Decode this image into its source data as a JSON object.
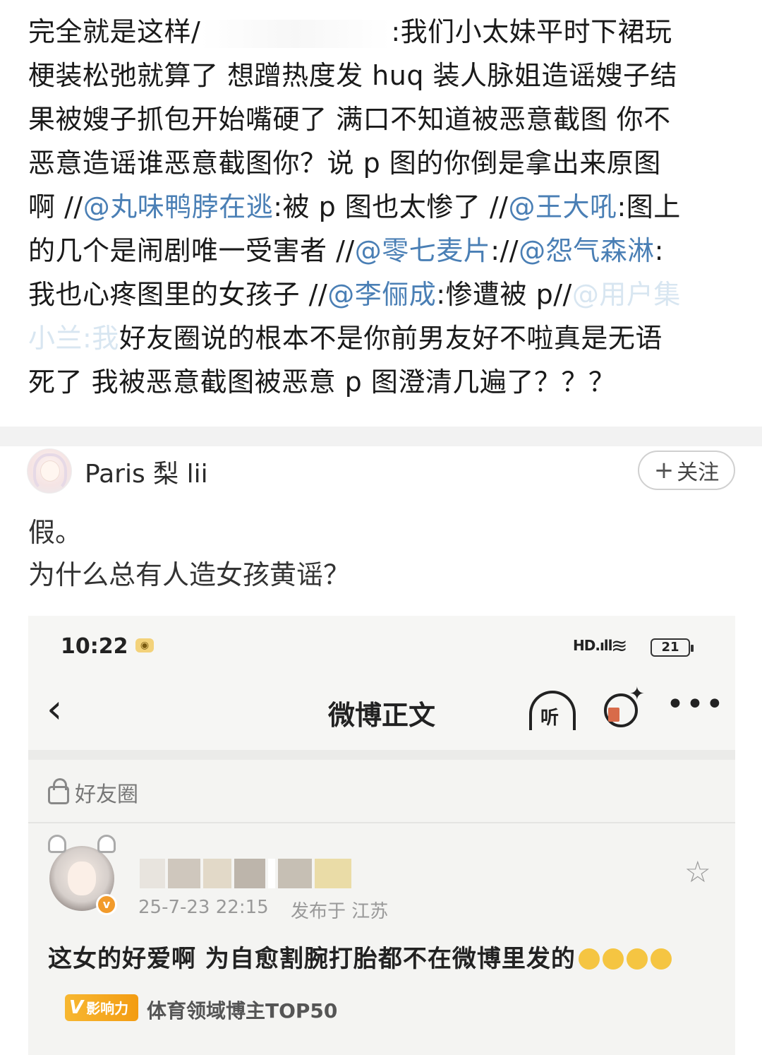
{
  "repost": {
    "lead": "完全就是这样/",
    "line1_rest": ":我们小太妹平时下裙玩",
    "line2": "梗装松弛就算了 想蹭热度发 huq 装人脉姐造谣嫂子结",
    "line3": "果被嫂子抓包开始嘴硬了 满口不知道被恶意截图 你不",
    "line4": "恶意造谣谁恶意截图你？说 p 图的你倒是拿出来原图",
    "line5_a": "啊 //",
    "mention1": "@丸味鸭脖在逃",
    "line5_b": ":被 p 图也太惨了 //",
    "mention2": "@王大吼",
    "line5_c": ":图上",
    "line6_a": "的几个是闹剧唯一受害者 //",
    "mention3": "@零七麦片",
    "line6_b": "://",
    "mention4": "@怨气森淋",
    "line6_c": ":",
    "line7_a": "我也心疼图里的女孩子 //",
    "mention5": "@李俪成",
    "line7_b": ":惨遭被 p//",
    "mention6_faded": "@用户集",
    "line8_faded": "小兰:我",
    "line8_rest": "好友圈说的根本不是你前男友好不啦真是无语",
    "line9": "死了 我被恶意截图被恶意 p 图澄清几遍了？？？"
  },
  "comment": {
    "username": "Paris 梨 lii",
    "follow_label": "关注",
    "follow_plus": "+",
    "body_line1": "假。",
    "body_line2": "为什么总有人造女孩黄谣？"
  },
  "embedded": {
    "status": {
      "time": "10:22",
      "signal": "HD.ıll",
      "battery": "21"
    },
    "nav": {
      "back": "‹",
      "title": "微博正文",
      "listen_label": "听",
      "more": "•••"
    },
    "circle_label": "好友圈",
    "post": {
      "date": "25-7-23 22:15",
      "location": "发布于 江苏",
      "text": "这女的好爱啊 为自愈割腕打胎都不在微博里发的",
      "badge_v": "V",
      "badge_text": "影响力",
      "badge_label": "体育领域博主TOP50",
      "verified_mark": "v",
      "star": "☆"
    }
  },
  "colors": {
    "mention": "#4a7fb5",
    "badge": "#f39c12",
    "separator": "#f2f2f2"
  }
}
